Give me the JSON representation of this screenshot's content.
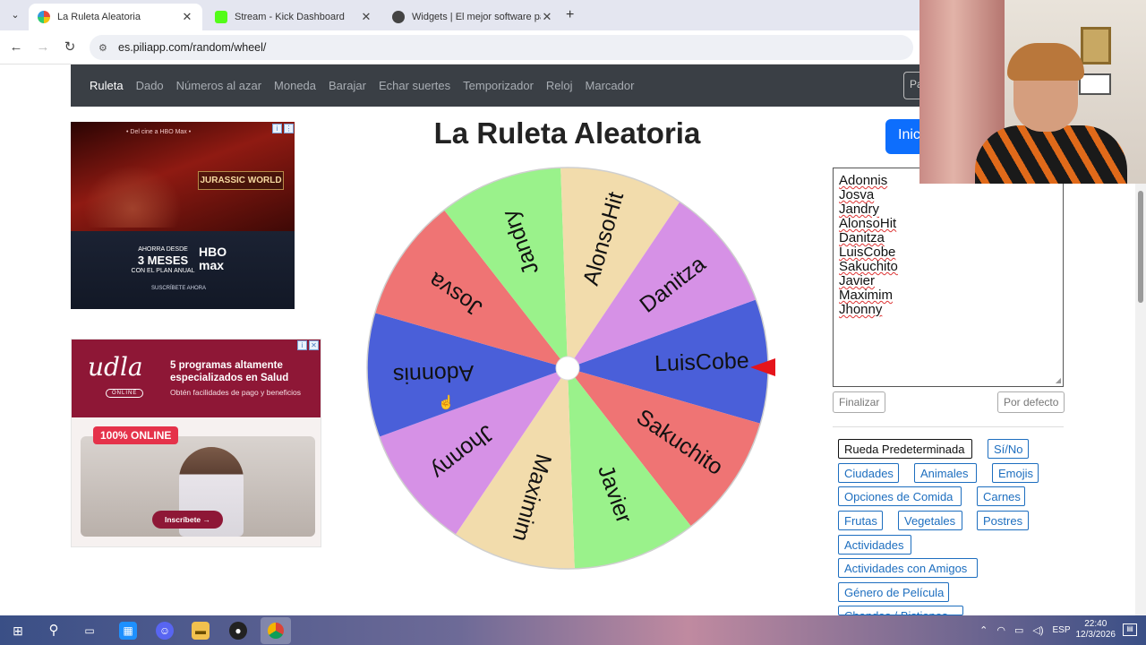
{
  "browser": {
    "tabs": [
      {
        "title": "La Ruleta Aleatoria",
        "active": true,
        "favicon_color": "#6a4bd1"
      },
      {
        "title": "Stream - Kick Dashboard",
        "active": false,
        "favicon_color": "#53fc18"
      },
      {
        "title": "Widgets | El mejor software par",
        "active": false,
        "favicon_color": "#444444"
      }
    ],
    "url": "es.piliapp.com/random/wheel/"
  },
  "site_nav": {
    "items": [
      "Ruleta",
      "Dado",
      "Números al azar",
      "Moneda",
      "Barajar",
      "Echar suertes",
      "Temporizador",
      "Reloj",
      "Marcador"
    ],
    "active": "Ruleta",
    "right_box_text": "Pa"
  },
  "ads": {
    "ad1": {
      "tagline": "• Del cine a HBO Max •",
      "movie": "JURASSIC WORLD",
      "offer_top": "AHORRA DESDE",
      "offer_big": "3 MESES",
      "offer_bottom": "CON EL PLAN ANUAL",
      "logo_line1": "HBO",
      "logo_line2": "max",
      "cta": "SUSCRÍBETE AHORA"
    },
    "ad2": {
      "brand": "udla",
      "brand_tag": "ONLINE",
      "headline": "5 programas altamente especializados en Salud",
      "sub": "Obtén facilidades de pago y beneficios",
      "badge": "100% ONLINE",
      "button": "Inscríbete →"
    }
  },
  "main": {
    "title": "La Ruleta Aleatoria",
    "start_button": "Inic"
  },
  "wheel": {
    "segments": [
      {
        "label": "LuisCobe",
        "color": "#4a5fd9"
      },
      {
        "label": "Sakuchito",
        "color": "#ef7474"
      },
      {
        "label": "Javier",
        "color": "#9af28b"
      },
      {
        "label": "Maximim",
        "color": "#f2dcac"
      },
      {
        "label": "Jhonny",
        "color": "#d691e6"
      },
      {
        "label": "Adonnis",
        "color": "#4a5fd9"
      },
      {
        "label": "Josva",
        "color": "#ef7474"
      },
      {
        "label": "Jandry",
        "color": "#9af28b"
      },
      {
        "label": "AlonsoHit",
        "color": "#f2dcac"
      },
      {
        "label": "Danitza",
        "color": "#d691e6"
      }
    ],
    "pointer_color": "#e5141b"
  },
  "names_list": [
    "Adonnis",
    "Josva",
    "Jandry",
    "AlonsoHit",
    "Danitza",
    "LuisCobe",
    "Sakuchito",
    "Javier",
    "Maximim",
    "Jhonny"
  ],
  "buttons": {
    "finish": "Finalizar",
    "default": "Por defecto"
  },
  "presets": [
    {
      "label": "Rueda Predeterminada",
      "selected": true
    },
    {
      "label": "Sí/No",
      "selected": false
    },
    {
      "label": "Ciudades",
      "selected": false
    },
    {
      "label": "Animales",
      "selected": false
    },
    {
      "label": "Emojis",
      "selected": false
    },
    {
      "label": "Opciones de Comida",
      "selected": false
    },
    {
      "label": "Carnes",
      "selected": false
    },
    {
      "label": "Frutas",
      "selected": false
    },
    {
      "label": "Vegetales",
      "selected": false
    },
    {
      "label": "Postres",
      "selected": false
    },
    {
      "label": "Actividades",
      "selected": false
    },
    {
      "label": "Actividades con Amigos",
      "selected": false
    },
    {
      "label": "Género de Película",
      "selected": false
    },
    {
      "label": "Chandas / Bistionos",
      "selected": false
    }
  ],
  "taskbar": {
    "language": "ESP",
    "time": "22:40",
    "date": "12/3/2026"
  }
}
